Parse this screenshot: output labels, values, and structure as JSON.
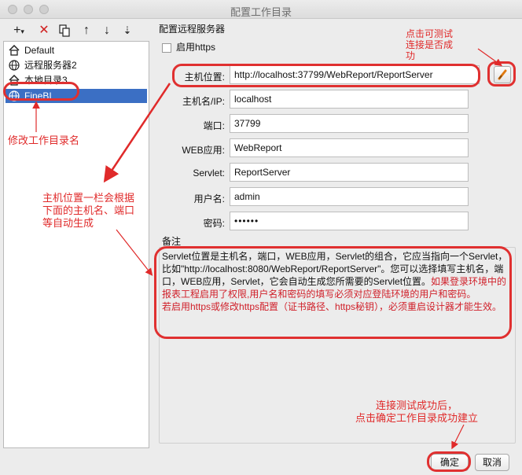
{
  "window": {
    "title": "配置工作目录"
  },
  "toolbar": {
    "add_icon": "plus-dropdown-icon",
    "delete_icon": "red-x-icon",
    "copy_icon": "copy-icon",
    "up_icon": "arrow-up-icon",
    "down_icon": "arrow-down-icon",
    "sort_icon": "sort-icon"
  },
  "tree": {
    "items": [
      {
        "label": "Default",
        "icon": "home-icon",
        "selected": false
      },
      {
        "label": "远程服务器2",
        "icon": "globe-icon",
        "selected": false
      },
      {
        "label": "本地目录3",
        "icon": "home-icon",
        "selected": false
      },
      {
        "label": "FineBI",
        "icon": "globe-icon",
        "selected": true
      }
    ]
  },
  "form": {
    "section_title": "配置远程服务器",
    "https_label": "启用https",
    "https_checked": false,
    "host_position_label": "主机位置:",
    "host_position_value": "http://localhost:37799/WebReport/ReportServer",
    "host_label": "主机名/IP:",
    "host_value": "localhost",
    "port_label": "端口:",
    "port_value": "37799",
    "webapp_label": "WEB应用:",
    "webapp_value": "WebReport",
    "servlet_label": "Servlet:",
    "servlet_value": "ReportServer",
    "username_label": "用户名:",
    "username_value": "admin",
    "password_label": "密码:",
    "password_value": "••••••"
  },
  "notes": {
    "label": "备注",
    "text_black": "Servlet位置是主机名，端口，WEB应用，Servlet的组合，它应当指向一个Servlet，比如\"http://localhost:8080/WebReport/ReportServer\"。您可以选择填写主机名，端口，WEB应用，Servlet，它会自动生成您所需要的Servlet位置。",
    "text_red_1": "如果登录环境中的报表工程启用了权限,用户名和密码的填写必须对应登陆环境的用户和密码。",
    "text_red_2": "若启用https或修改https配置（证书路径、https秘钥），必须重启设计器才能生效。"
  },
  "buttons": {
    "ok": "确定",
    "cancel": "取消"
  },
  "annotations": {
    "rename": "修改工作目录名",
    "test": "点击可测试\n连接是否成\n功",
    "autogen": "主机位置一栏会根据\n下面的主机名、端口\n等自动生成",
    "success": "连接测试成功后，\n点击确定工作目录成功建立"
  },
  "colors": {
    "selection": "#3b6fc4",
    "annotation": "#e02a2a"
  }
}
